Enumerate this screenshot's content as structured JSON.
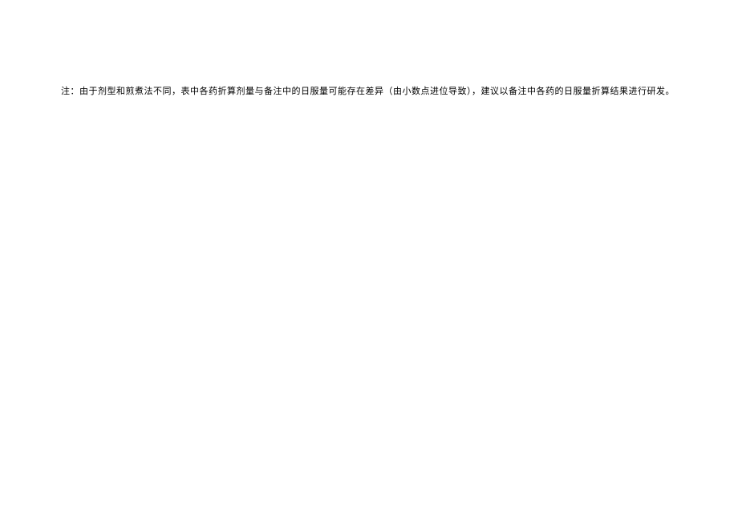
{
  "note": {
    "text": "注：由于剂型和煎煮法不同，表中各药折算剂量与备注中的日服量可能存在差异（由小数点进位导致），建议以备注中各药的日服量折算结果进行研发。"
  }
}
